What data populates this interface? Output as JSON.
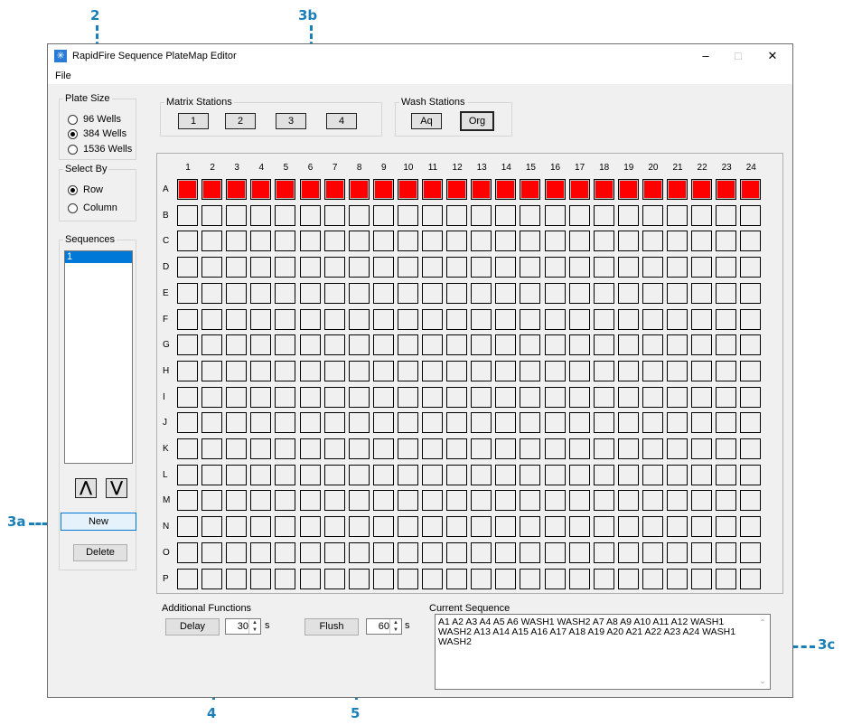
{
  "callouts": {
    "c2": "2",
    "c3b": "3b",
    "c3a": "3a",
    "c3c": "3c",
    "c4": "4",
    "c5": "5"
  },
  "window": {
    "title": "RapidFire Sequence PlateMap Editor",
    "minimize": "–",
    "maximize": "□",
    "close": "✕"
  },
  "menu": {
    "file": "File"
  },
  "plate_size": {
    "legend": "Plate Size",
    "options": [
      "96 Wells",
      "384 Wells",
      "1536 Wells"
    ],
    "selected": "384 Wells"
  },
  "select_by": {
    "legend": "Select By",
    "options": [
      "Row",
      "Column"
    ],
    "selected": "Row"
  },
  "sequences": {
    "legend": "Sequences",
    "items": [
      "1"
    ],
    "up_label": "⋀",
    "down_label": "⋁",
    "new_label": "New",
    "delete_label": "Delete"
  },
  "matrix_stations": {
    "legend": "Matrix Stations",
    "buttons": [
      "1",
      "2",
      "3",
      "4"
    ]
  },
  "wash_stations": {
    "legend": "Wash Stations",
    "buttons": [
      "Aq",
      "Org"
    ]
  },
  "plate": {
    "columns": [
      "1",
      "2",
      "3",
      "4",
      "5",
      "6",
      "7",
      "8",
      "9",
      "10",
      "11",
      "12",
      "13",
      "14",
      "15",
      "16",
      "17",
      "18",
      "19",
      "20",
      "21",
      "22",
      "23",
      "24"
    ],
    "rows": [
      "A",
      "B",
      "C",
      "D",
      "E",
      "F",
      "G",
      "H",
      "I",
      "J",
      "K",
      "L",
      "M",
      "N",
      "O",
      "P"
    ],
    "selected_row": "A",
    "selected_color": "#ff0000"
  },
  "additional_functions": {
    "legend": "Additional Functions",
    "delay_label": "Delay",
    "delay_value": "30",
    "flush_label": "Flush",
    "flush_value": "60",
    "unit": "s"
  },
  "current_sequence": {
    "legend": "Current Sequence",
    "text": "A1 A2 A3 A4 A5 A6 WASH1 WASH2 A7 A8 A9 A10 A11 A12 WASH1 WASH2 A13 A14 A15 A16 A17 A18 A19 A20 A21 A22 A23 A24 WASH1 WASH2"
  },
  "colors": {
    "callout": "#1a7fb8",
    "accent": "#0078d7"
  }
}
